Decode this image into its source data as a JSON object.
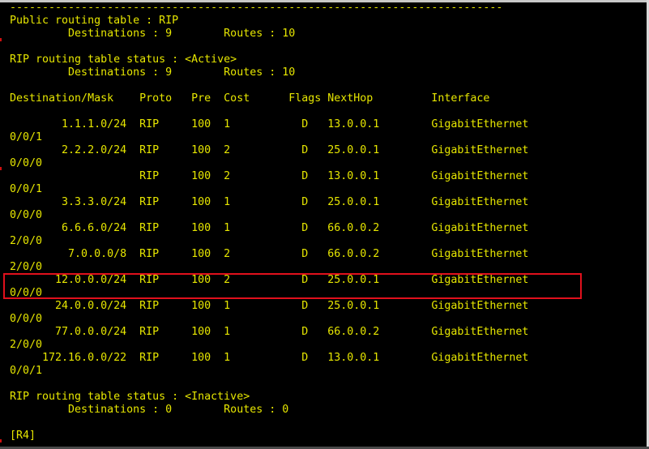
{
  "terminal": {
    "lines": [
      "----------------------------------------------------------------------------",
      "Public routing table : RIP",
      "         Destinations : 9        Routes : 10",
      "",
      "RIP routing table status : <Active>",
      "         Destinations : 9        Routes : 10",
      "",
      "Destination/Mask    Proto   Pre  Cost      Flags NextHop         Interface",
      "",
      "        1.1.1.0/24  RIP     100  1           D   13.0.0.1        GigabitEthernet",
      "0/0/1",
      "        2.2.2.0/24  RIP     100  2           D   25.0.0.1        GigabitEthernet",
      "0/0/0",
      "                    RIP     100  2           D   13.0.0.1        GigabitEthernet",
      "0/0/1",
      "        3.3.3.0/24  RIP     100  1           D   25.0.0.1        GigabitEthernet",
      "0/0/0",
      "        6.6.6.0/24  RIP     100  1           D   66.0.0.2        GigabitEthernet",
      "2/0/0",
      "         7.0.0.0/8  RIP     100  2           D   66.0.0.2        GigabitEthernet",
      "2/0/0",
      "       12.0.0.0/24  RIP     100  2           D   25.0.0.1        GigabitEthernet",
      "0/0/0",
      "       24.0.0.0/24  RIP     100  1           D   25.0.0.1        GigabitEthernet",
      "0/0/0",
      "       77.0.0.0/24  RIP     100  1           D   66.0.0.2        GigabitEthernet",
      "2/0/0",
      "     172.16.0.0/22  RIP     100  1           D   13.0.0.1        GigabitEthernet",
      "0/0/1",
      "",
      "RIP routing table status : <Inactive>",
      "         Destinations : 0        Routes : 0",
      "",
      "[R4]"
    ]
  },
  "colors": {
    "background": "#000000",
    "text": "#e6e600",
    "highlight_border": "#e0101c"
  }
}
